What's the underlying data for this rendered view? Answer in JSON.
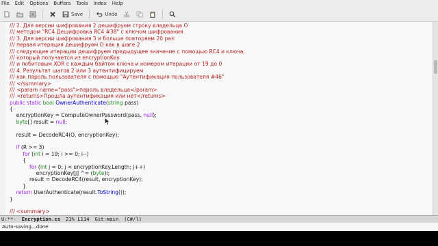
{
  "menu": [
    "File",
    "Edit",
    "Options",
    "Buffers",
    "Tools",
    "Index",
    "Help"
  ],
  "toolbar": {
    "save_label": "Save",
    "undo_label": "Undo"
  },
  "code_lines": [
    "/// 2. Для версии шифрования 2 дешифруем строку владельца O",
    "/// методом \"RC4 Дешифровка RC4 #38\" с ключом шифрования",
    "/// 3. Для версии шифрования 3 и больше повторяем 20 раз:",
    "/// первая итерация дешифруем O как в шаге 2",
    "/// следующие итерации дешифруем предыдущее значение с помощью RC4 и ключа,",
    "/// который получается из encryptionKey",
    "/// и побитовым XOR с каждым байтом ключа и номером итерации от 19 до 0",
    "/// 4. Результат шагов 2 или 3 аутентифицируем",
    "/// как пароль пользователя с помощью \"Аутентификация пользователя #46\"",
    "/// </summary>",
    "/// <param name=\"pass\">пароль владельца</param>",
    "/// <returns>Прошла аутентификация или нет</returns>",
    "public static bool OwnerAuthenticate(string pass)",
    "{",
    "    encryptionKey = ComputeOwnerPassword(pass, null);",
    "    byte[] result = null;",
    "",
    "    result = DecodeRC4(O, encryptionKey);",
    "",
    "    if (R >= 3)",
    "        for (int i = 19; i >= 0; i--)",
    "        {",
    "            for (int j = 0; j < encryptionKey.Length; j++)",
    "                encryptionKey[j] ^= (byte)i;",
    "            result = DecodeRC4(result, encryptionKey);",
    "        }",
    "    return UserAuthenticate(result.ToString());",
    "}",
    "",
    "/// <summary>"
  ],
  "modeline": {
    "flags": "U:**-",
    "buffer_name": "Encryption.cs",
    "position": "21% L114",
    "vcs": "Git:main",
    "mode": "(C#/l)"
  },
  "echo_area": "Auto-saving...done",
  "colors": {
    "comment": "#b22222",
    "keyword": "#a020f0",
    "type": "#228b22",
    "function": "#0000cd"
  }
}
